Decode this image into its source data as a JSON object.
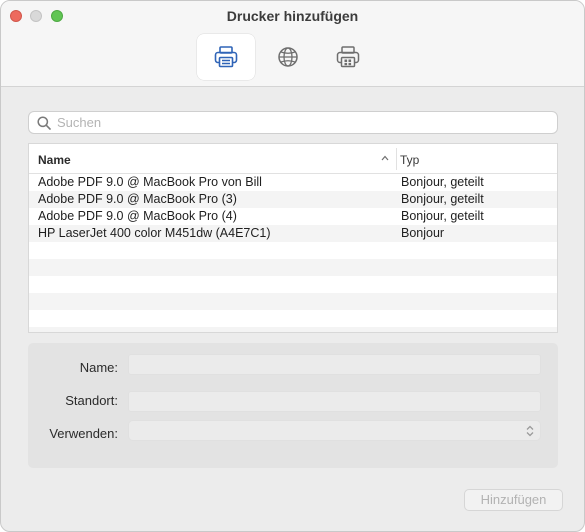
{
  "window": {
    "title": "Drucker hinzufügen"
  },
  "toolbar": {
    "tools": [
      {
        "icon": "default-printer-icon",
        "active": true
      },
      {
        "icon": "ip-globe-icon",
        "active": false
      },
      {
        "icon": "windows-printer-icon",
        "active": false
      }
    ]
  },
  "search": {
    "placeholder": "Suchen",
    "value": ""
  },
  "table": {
    "columns": {
      "name": "Name",
      "type": "Typ"
    },
    "sort": {
      "column": "name",
      "direction": "ascending",
      "icon": "chevron-up-icon"
    },
    "rows": [
      {
        "name": "Adobe PDF 9.0 @ MacBook Pro von Bill",
        "type": "Bonjour, geteilt"
      },
      {
        "name": "Adobe PDF 9.0 @ MacBook Pro (3)",
        "type": "Bonjour, geteilt"
      },
      {
        "name": "Adobe PDF 9.0 @ MacBook Pro (4)",
        "type": "Bonjour, geteilt"
      },
      {
        "name": "HP LaserJet 400 color M451dw (A4E7C1)",
        "type": "Bonjour"
      }
    ]
  },
  "details": {
    "name_label": "Name:",
    "location_label": "Standort:",
    "use_label": "Verwenden:",
    "name_value": "",
    "location_value": "",
    "use_value": ""
  },
  "actions": {
    "add_label": "Hinzufügen",
    "add_enabled": false
  },
  "colors": {
    "close": "#ed6a5e",
    "minimize": "#d9d9d9",
    "zoom": "#61c554",
    "accent": "#2f64b7"
  }
}
